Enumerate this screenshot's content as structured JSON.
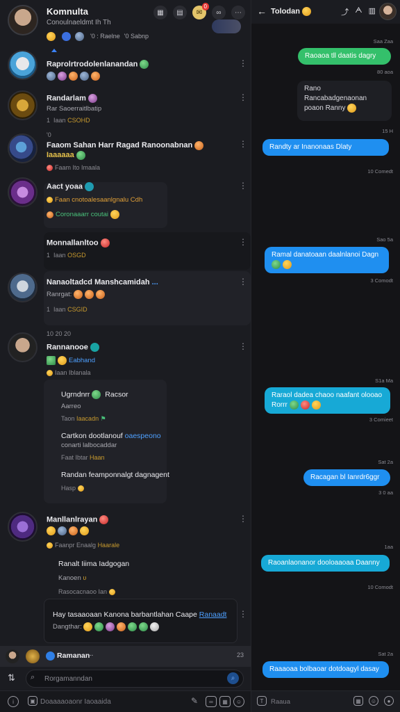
{
  "left_header": {
    "title": "Komnulta",
    "subtitle": "Conoulnaeldmt Ih  Th",
    "chips": [
      "'0 : Raelne",
      "'0  Sabnp"
    ],
    "notification_count": "0"
  },
  "conversations": [
    {
      "name": "Raprolrtrodolenlanandan",
      "emoji_count": 4
    },
    {
      "name": "Randarlam",
      "line": "Rar Saoerraitlbatip",
      "meta_prefix": "1",
      "meta_label": "Iaan",
      "meta_gold": "CSOHD"
    },
    {
      "name": "Faaom Sahan Harr Ragad Ranoonabnan",
      "name_tag": "Iaaaaaa",
      "line_prefix": "'0",
      "meta": "Faam Ito Imaala"
    },
    {
      "name": "Aact yoaa",
      "line": "Faan cnotoalesaanlgnalu Cdh",
      "line2": "Coronaaarr coutai"
    },
    {
      "name": "Monnallanltoo",
      "meta_prefix": "1",
      "meta_label": "Iaan",
      "meta_gold": "OSGD"
    },
    {
      "name": "Nanaoltadcd Manshcamidah",
      "line": "Ranrgat:",
      "meta_prefix": "1",
      "meta_label": "Iaan",
      "meta_gold": "CSGID"
    },
    {
      "time": "10 20 20",
      "name": "Rannanooe",
      "tag": "Eabhand",
      "meta": "Iaan Iblanala",
      "sub": [
        {
          "title": "Ugrndnrr",
          "tag": "Racsor",
          "line": "Aarreo",
          "meta_label": "Taon",
          "meta_gold": "Iaacadn"
        },
        {
          "title": "Cartkon dootlanouf",
          "tag": "oaespeono",
          "line": "conarti lalbocaddar",
          "meta_label": "Faat Ibtar",
          "meta_gold": "Haan"
        },
        {
          "title": "Randan feamponnalgt dagnagent",
          "meta_label": "Hasp"
        }
      ]
    },
    {
      "name": "Manllanlrayan",
      "meta": "Faanpr Enaalg",
      "meta_gold": "Haarale",
      "sub": [
        {
          "title": "Ranalt Iiima Iadgogan",
          "line": "Kanoen",
          "meta": "Rasocacnaoo Ian"
        }
      ]
    },
    {
      "name": "Hay tasaaoaan Kanona barbantlahan Caape",
      "link": "Ranaadt",
      "line": "Dangthar:"
    }
  ],
  "compose_strip": {
    "label": "Ramanan",
    "dots": "...",
    "time": "23"
  },
  "search": {
    "placeholder": "Rorgamanndan"
  },
  "bottom_bar": {
    "placeholder": "Doaaaaoaonr Iaoaaida"
  },
  "right_header": {
    "title": "Tolodan"
  },
  "messages": [
    {
      "text": "Raoaoa tll daatis dagry",
      "meta_top": "Saa Zaa",
      "meta_bottom": "80 aoa",
      "color": "green"
    },
    {
      "text": "Rano Rancabadgenaonan poaon Ranny",
      "color": "dark"
    },
    {
      "text": "Randty ar Inanonaas Dlaty",
      "meta_top": "15 H",
      "meta_bottom": "10 Comedt",
      "color": "blue"
    },
    {
      "text": "Ramal danatoaan daalnlanoi Dagn",
      "meta_top": "Sao 5a",
      "meta_bottom": "3 Comodt",
      "color": "blue"
    },
    {
      "text": "Raraol dadea chaoo naafant olooao Rorrr",
      "meta_top": "S1a Ma",
      "meta_bottom": "3 Comieet",
      "color": "cyan"
    },
    {
      "text": "Racagan bl Ianrdr6ggr",
      "meta_top": "Sat 2a",
      "meta_bottom": "3 0 aa",
      "color": "blue"
    },
    {
      "text": "Raoanlaonanor dooloaaoaa Daanny",
      "meta_top": "1aa",
      "meta_bottom": "10 Comodt",
      "color": "cyan"
    },
    {
      "text": "Raaaoaa bolbaoar dotdoagyl dasay",
      "meta_top": "Sat 2a",
      "color": "blue"
    }
  ],
  "right_footer": {
    "placeholder": "Raaua"
  }
}
